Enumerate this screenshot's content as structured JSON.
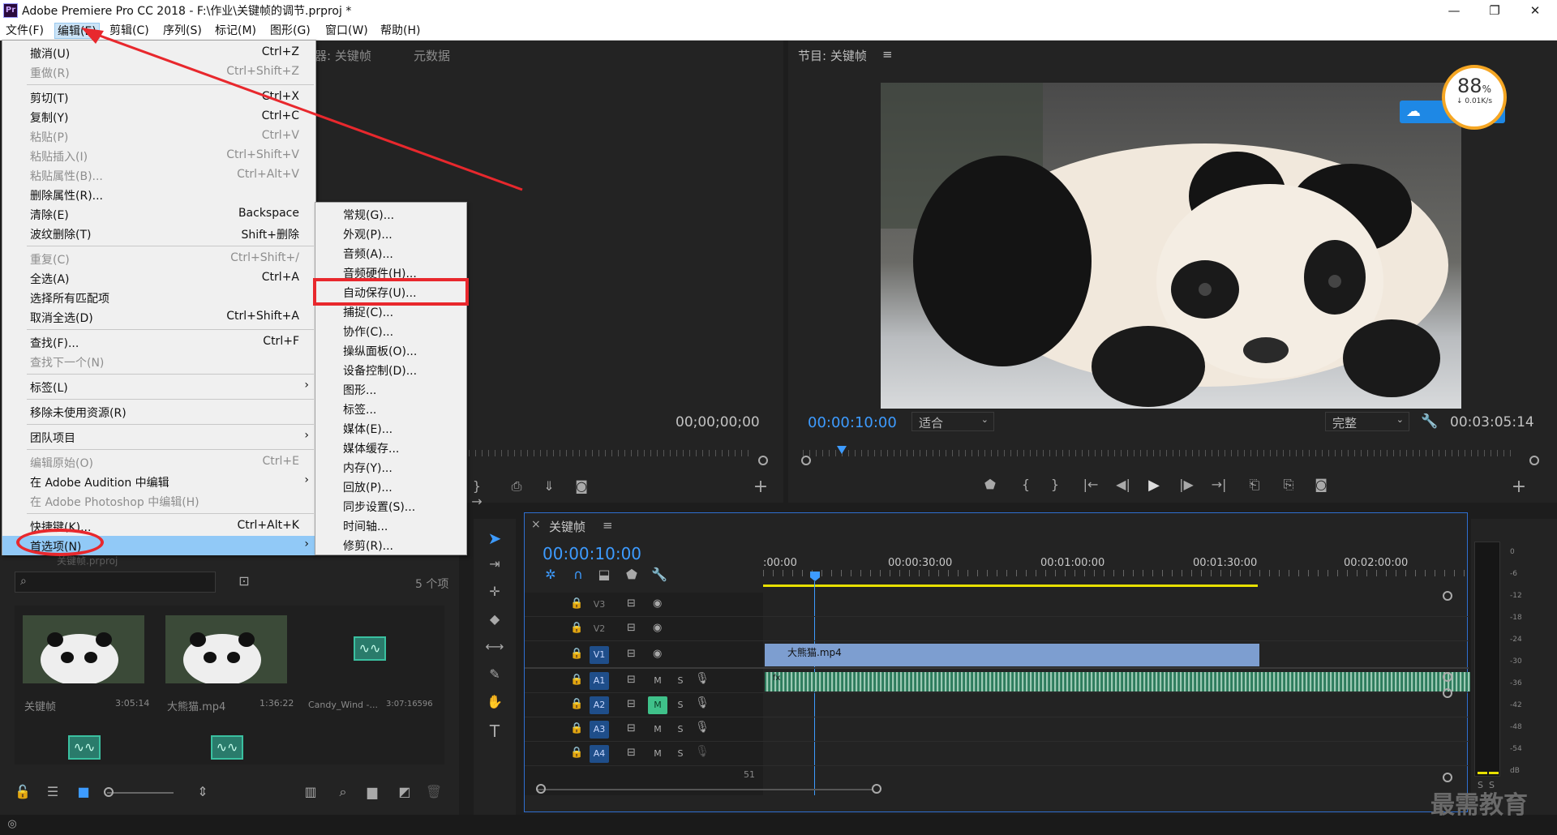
{
  "window": {
    "title": "Adobe Premiere Pro CC 2018 - F:\\作业\\关键帧的调节.prproj *",
    "logo_text": "Pr",
    "controls": [
      "—",
      "❐",
      "✕"
    ]
  },
  "menubar": [
    "文件(F)",
    "编辑(E)",
    "剪辑(C)",
    "序列(S)",
    "标记(M)",
    "图形(G)",
    "窗口(W)",
    "帮助(H)"
  ],
  "edit_menu": [
    {
      "label": "撤消(U)",
      "shortcut": "Ctrl+Z",
      "disabled": false
    },
    {
      "label": "重做(R)",
      "shortcut": "Ctrl+Shift+Z",
      "disabled": true
    },
    {
      "label": "剪切(T)",
      "shortcut": "Ctrl+X",
      "disabled": false
    },
    {
      "label": "复制(Y)",
      "shortcut": "Ctrl+C",
      "disabled": false
    },
    {
      "label": "粘贴(P)",
      "shortcut": "Ctrl+V",
      "disabled": true
    },
    {
      "label": "粘贴插入(I)",
      "shortcut": "Ctrl+Shift+V",
      "disabled": true
    },
    {
      "label": "粘贴属性(B)...",
      "shortcut": "Ctrl+Alt+V",
      "disabled": true
    },
    {
      "label": "删除属性(R)...",
      "shortcut": "",
      "disabled": false
    },
    {
      "label": "清除(E)",
      "shortcut": "Backspace",
      "disabled": false
    },
    {
      "label": "波纹删除(T)",
      "shortcut": "Shift+删除",
      "disabled": false
    },
    {
      "label": "重复(C)",
      "shortcut": "Ctrl+Shift+/",
      "disabled": true
    },
    {
      "label": "全选(A)",
      "shortcut": "Ctrl+A",
      "disabled": false
    },
    {
      "label": "选择所有匹配项",
      "shortcut": "",
      "disabled": false
    },
    {
      "label": "取消全选(D)",
      "shortcut": "Ctrl+Shift+A",
      "disabled": false
    },
    {
      "label": "查找(F)...",
      "shortcut": "Ctrl+F",
      "disabled": false
    },
    {
      "label": "查找下一个(N)",
      "shortcut": "",
      "disabled": true
    },
    {
      "label": "标签(L)",
      "shortcut": "",
      "disabled": false,
      "submenu": true
    },
    {
      "label": "移除未使用资源(R)",
      "shortcut": "",
      "disabled": false
    },
    {
      "label": "团队项目",
      "shortcut": "",
      "disabled": false,
      "submenu": true
    },
    {
      "label": "编辑原始(O)",
      "shortcut": "Ctrl+E",
      "disabled": true
    },
    {
      "label": "在 Adobe Audition 中编辑",
      "shortcut": "",
      "disabled": false,
      "submenu": true
    },
    {
      "label": "在 Adobe Photoshop 中编辑(H)",
      "shortcut": "",
      "disabled": true
    },
    {
      "label": "快捷键(K)...",
      "shortcut": "Ctrl+Alt+K",
      "disabled": false
    },
    {
      "label": "首选项(N)",
      "shortcut": "",
      "disabled": false,
      "submenu": true,
      "highlighted": true
    }
  ],
  "preferences_submenu": [
    "常规(G)...",
    "外观(P)...",
    "音频(A)...",
    "音频硬件(H)...",
    "自动保存(U)...",
    "捕捉(C)...",
    "协作(C)...",
    "操纵面板(O)...",
    "设备控制(D)...",
    "图形...",
    "标签...",
    "媒体(E)...",
    "媒体缓存...",
    "内存(Y)...",
    "回放(P)...",
    "同步设置(S)...",
    "时间轴...",
    "修剪(R)..."
  ],
  "source_panel": {
    "tabs": [
      "器: 关键帧",
      "元数据"
    ],
    "timecode": "00;00;00;00"
  },
  "program_panel": {
    "title": "节目: 关键帧",
    "menu_icon": "≡",
    "timecode_left": "00:00:10:00",
    "fit": "适合",
    "quality": "完整",
    "timecode_right": "00:03:05:14"
  },
  "speed_widget": {
    "percent": "88",
    "percent_unit": "%",
    "rate": "↓ 0.01K/s"
  },
  "project_panel": {
    "project_label": "关键帧.prproj",
    "item_count": "5 个项",
    "items": [
      {
        "name": "关键帧",
        "duration": "3:05:14",
        "kind": "video"
      },
      {
        "name": "大熊猫.mp4",
        "duration": "1:36:22",
        "kind": "video"
      },
      {
        "name": "Candy_Wind -...",
        "duration": "3:07:16596",
        "kind": "audio"
      },
      {
        "name": "",
        "duration": "",
        "kind": "audio"
      },
      {
        "name": "",
        "duration": "",
        "kind": "audio"
      }
    ]
  },
  "timeline": {
    "tab_title": "关键帧",
    "close": "×",
    "menu_icon": "≡",
    "timecode": "00:00:10:00",
    "ruler_labels": [
      ":00:00",
      "00:00:30:00",
      "00:01:00:00",
      "00:01:30:00",
      "00:02:00:00"
    ],
    "video_tracks": [
      "V3",
      "V2",
      "V1"
    ],
    "audio_tracks": [
      "A1",
      "A2",
      "A3",
      "A4"
    ],
    "mute_label": "M",
    "solo_label": "S",
    "video_clip": "大熊猫.mp4",
    "audio_clip": "fx",
    "master_value": "51"
  },
  "meter_scale": [
    "0",
    "-6",
    "-12",
    "-18",
    "-24",
    "-30",
    "-36",
    "-42",
    "-48",
    "-54",
    "dB"
  ],
  "meter_solo": [
    "S",
    "S"
  ],
  "watermark": "最需教育"
}
